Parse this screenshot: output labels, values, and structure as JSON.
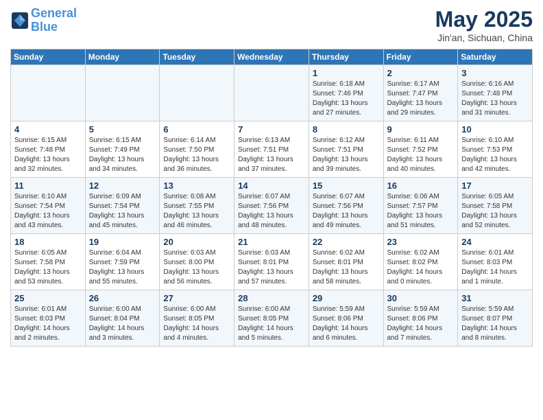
{
  "header": {
    "logo_line1": "General",
    "logo_line2": "Blue",
    "month": "May 2025",
    "location": "Jin'an, Sichuan, China"
  },
  "days_of_week": [
    "Sunday",
    "Monday",
    "Tuesday",
    "Wednesday",
    "Thursday",
    "Friday",
    "Saturday"
  ],
  "weeks": [
    [
      {
        "day": "",
        "info": ""
      },
      {
        "day": "",
        "info": ""
      },
      {
        "day": "",
        "info": ""
      },
      {
        "day": "",
        "info": ""
      },
      {
        "day": "1",
        "info": "Sunrise: 6:18 AM\nSunset: 7:46 PM\nDaylight: 13 hours\nand 27 minutes."
      },
      {
        "day": "2",
        "info": "Sunrise: 6:17 AM\nSunset: 7:47 PM\nDaylight: 13 hours\nand 29 minutes."
      },
      {
        "day": "3",
        "info": "Sunrise: 6:16 AM\nSunset: 7:48 PM\nDaylight: 13 hours\nand 31 minutes."
      }
    ],
    [
      {
        "day": "4",
        "info": "Sunrise: 6:15 AM\nSunset: 7:48 PM\nDaylight: 13 hours\nand 32 minutes."
      },
      {
        "day": "5",
        "info": "Sunrise: 6:15 AM\nSunset: 7:49 PM\nDaylight: 13 hours\nand 34 minutes."
      },
      {
        "day": "6",
        "info": "Sunrise: 6:14 AM\nSunset: 7:50 PM\nDaylight: 13 hours\nand 36 minutes."
      },
      {
        "day": "7",
        "info": "Sunrise: 6:13 AM\nSunset: 7:51 PM\nDaylight: 13 hours\nand 37 minutes."
      },
      {
        "day": "8",
        "info": "Sunrise: 6:12 AM\nSunset: 7:51 PM\nDaylight: 13 hours\nand 39 minutes."
      },
      {
        "day": "9",
        "info": "Sunrise: 6:11 AM\nSunset: 7:52 PM\nDaylight: 13 hours\nand 40 minutes."
      },
      {
        "day": "10",
        "info": "Sunrise: 6:10 AM\nSunset: 7:53 PM\nDaylight: 13 hours\nand 42 minutes."
      }
    ],
    [
      {
        "day": "11",
        "info": "Sunrise: 6:10 AM\nSunset: 7:54 PM\nDaylight: 13 hours\nand 43 minutes."
      },
      {
        "day": "12",
        "info": "Sunrise: 6:09 AM\nSunset: 7:54 PM\nDaylight: 13 hours\nand 45 minutes."
      },
      {
        "day": "13",
        "info": "Sunrise: 6:08 AM\nSunset: 7:55 PM\nDaylight: 13 hours\nand 46 minutes."
      },
      {
        "day": "14",
        "info": "Sunrise: 6:07 AM\nSunset: 7:56 PM\nDaylight: 13 hours\nand 48 minutes."
      },
      {
        "day": "15",
        "info": "Sunrise: 6:07 AM\nSunset: 7:56 PM\nDaylight: 13 hours\nand 49 minutes."
      },
      {
        "day": "16",
        "info": "Sunrise: 6:06 AM\nSunset: 7:57 PM\nDaylight: 13 hours\nand 51 minutes."
      },
      {
        "day": "17",
        "info": "Sunrise: 6:05 AM\nSunset: 7:58 PM\nDaylight: 13 hours\nand 52 minutes."
      }
    ],
    [
      {
        "day": "18",
        "info": "Sunrise: 6:05 AM\nSunset: 7:58 PM\nDaylight: 13 hours\nand 53 minutes."
      },
      {
        "day": "19",
        "info": "Sunrise: 6:04 AM\nSunset: 7:59 PM\nDaylight: 13 hours\nand 55 minutes."
      },
      {
        "day": "20",
        "info": "Sunrise: 6:03 AM\nSunset: 8:00 PM\nDaylight: 13 hours\nand 56 minutes."
      },
      {
        "day": "21",
        "info": "Sunrise: 6:03 AM\nSunset: 8:01 PM\nDaylight: 13 hours\nand 57 minutes."
      },
      {
        "day": "22",
        "info": "Sunrise: 6:02 AM\nSunset: 8:01 PM\nDaylight: 13 hours\nand 58 minutes."
      },
      {
        "day": "23",
        "info": "Sunrise: 6:02 AM\nSunset: 8:02 PM\nDaylight: 14 hours\nand 0 minutes."
      },
      {
        "day": "24",
        "info": "Sunrise: 6:01 AM\nSunset: 8:03 PM\nDaylight: 14 hours\nand 1 minute."
      }
    ],
    [
      {
        "day": "25",
        "info": "Sunrise: 6:01 AM\nSunset: 8:03 PM\nDaylight: 14 hours\nand 2 minutes."
      },
      {
        "day": "26",
        "info": "Sunrise: 6:00 AM\nSunset: 8:04 PM\nDaylight: 14 hours\nand 3 minutes."
      },
      {
        "day": "27",
        "info": "Sunrise: 6:00 AM\nSunset: 8:05 PM\nDaylight: 14 hours\nand 4 minutes."
      },
      {
        "day": "28",
        "info": "Sunrise: 6:00 AM\nSunset: 8:05 PM\nDaylight: 14 hours\nand 5 minutes."
      },
      {
        "day": "29",
        "info": "Sunrise: 5:59 AM\nSunset: 8:06 PM\nDaylight: 14 hours\nand 6 minutes."
      },
      {
        "day": "30",
        "info": "Sunrise: 5:59 AM\nSunset: 8:06 PM\nDaylight: 14 hours\nand 7 minutes."
      },
      {
        "day": "31",
        "info": "Sunrise: 5:59 AM\nSunset: 8:07 PM\nDaylight: 14 hours\nand 8 minutes."
      }
    ]
  ]
}
